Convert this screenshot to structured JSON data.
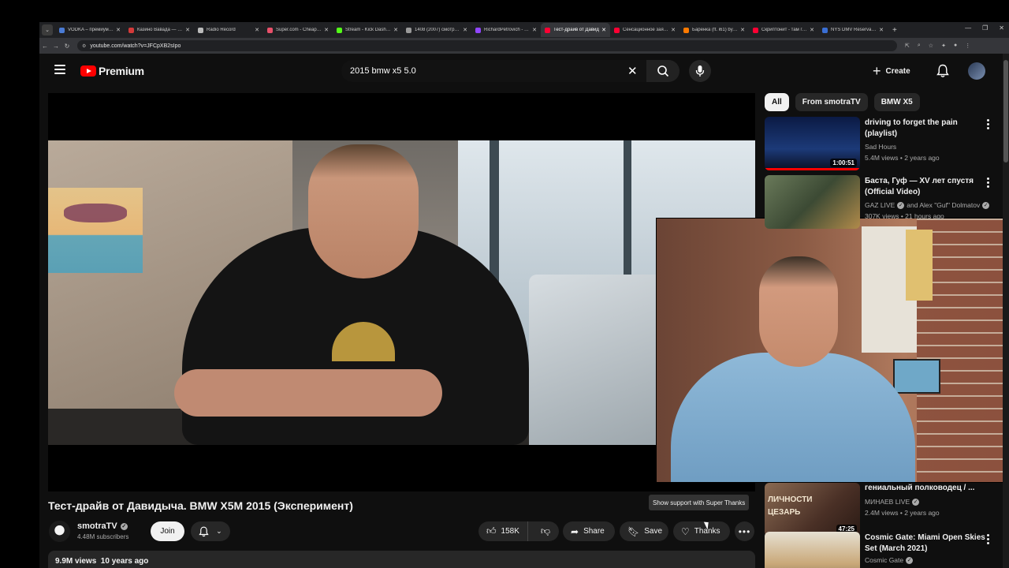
{
  "browser": {
    "tabs": [
      {
        "label": "VODKA – премиум он",
        "color": "#4a7bd4"
      },
      {
        "label": "Казино Вавада — Офи",
        "color": "#d43a3a"
      },
      {
        "label": "Radio Record",
        "color": "#bbbbbb"
      },
      {
        "label": "Super.com - Cheap ho",
        "color": "#e8506a"
      },
      {
        "label": "Stream - Kick Dashbo",
        "color": "#53fc18"
      },
      {
        "label": "1408 (2007) смотреть",
        "color": "#9a9a9a"
      },
      {
        "label": "RichardPetrovich - Tw",
        "color": "#9146ff"
      },
      {
        "label": "Тест-драйв от Давид",
        "color": "#ff0033"
      },
      {
        "label": "Сенсационное заявл",
        "color": "#ff0033"
      },
      {
        "label": "Баренка (ft. i61) by Pl",
        "color": "#ff7a00"
      },
      {
        "label": "Скриптонит - там где",
        "color": "#ff0033"
      },
      {
        "label": "NYS DMV Reservation",
        "color": "#3a6fd4"
      }
    ],
    "active_tab": 7,
    "url": "youtube.com/watch?v=JFCpXB2sIpo"
  },
  "header": {
    "logo_text": "Premium",
    "search_query": "2015 bmw x5 5.0",
    "create_label": "Create"
  },
  "video": {
    "title": "Тест-драйв от Давидыча. BMW X5M 2015 (Эксперимент)",
    "channel": "smotraTV",
    "subscribers": "4.48M subscribers",
    "join_label": "Join",
    "likes": "158K",
    "share_label": "Share",
    "save_label": "Save",
    "thanks_label": "Thanks",
    "tooltip": "Show support with Super Thanks",
    "description_stats": "9.9M views  10 years ago"
  },
  "sidebar": {
    "chips": [
      "All",
      "From smotraTV",
      "BMW X5"
    ],
    "recs": [
      {
        "title": "driving to forget the pain (playlist)",
        "channel": "Sad Hours",
        "meta": "5.4M views • 2 years ago",
        "duration": "1:00:51",
        "verified": false,
        "thumb": "#0d1a3a"
      },
      {
        "title": "Баста, Гуф — XV лет спустя (Official Video)",
        "channel": "GAZ LIVE",
        "channel_extra": "and Alex \"Guf\" Dolmatov",
        "meta": "307K views • 21 hours ago",
        "duration": "",
        "verified": true,
        "thumb": "#4a5a3a"
      },
      {
        "title": "гениальный полководец / ...",
        "channel": "МИНАЕВ LIVE",
        "meta": "2.4M views • 2 years ago",
        "duration": "47:25",
        "verified": true,
        "thumb": "#6b4a3a",
        "thumb_text": "ЛИЧНОСТИ ЦЕЗАРЬ"
      },
      {
        "title": "Cosmic Gate: Miami Open Skies Set (March 2021)",
        "channel": "Cosmic Gate",
        "meta": "",
        "duration": "",
        "verified": true,
        "thumb": "#c9b08a"
      }
    ]
  },
  "colors": {
    "brand": "#ff0000",
    "bg": "#0f0f0f",
    "pill": "#272727"
  }
}
